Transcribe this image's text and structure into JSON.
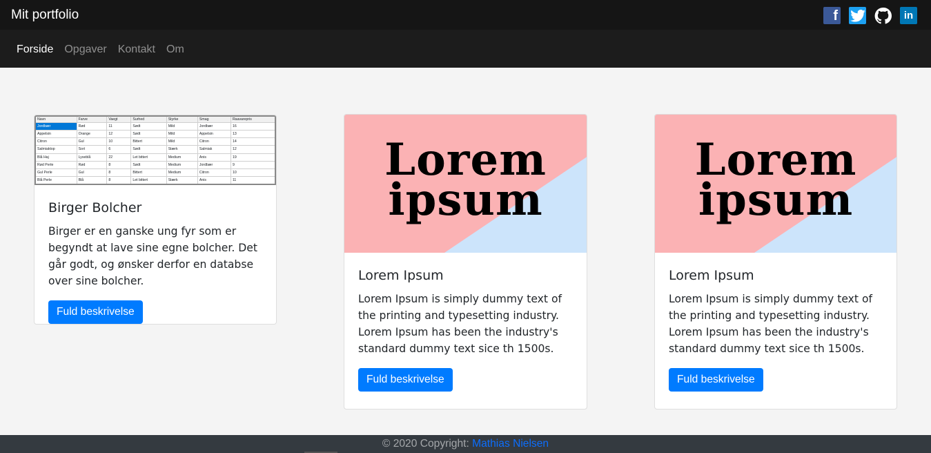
{
  "header": {
    "brand": "Mit portfolio"
  },
  "socials": [
    {
      "name": "facebook",
      "glyph": "f",
      "color": "#3b5998"
    },
    {
      "name": "twitter",
      "glyph": "t",
      "color": "#1da1f2"
    },
    {
      "name": "github",
      "glyph": "",
      "color": "#ffffff"
    },
    {
      "name": "linkedin",
      "glyph": "in",
      "color": "#0077b5"
    }
  ],
  "nav": [
    {
      "label": "Forside",
      "active": true
    },
    {
      "label": "Opgaver",
      "active": false
    },
    {
      "label": "Kontakt",
      "active": false
    },
    {
      "label": "Om",
      "active": false
    }
  ],
  "cards": [
    {
      "title": "Birger Bolcher",
      "text": "Birger er en ganske ung fyr som er begyndt at lave sine egne bolcher. Det går godt, og ønsker derfor en databse over sine bolcher.",
      "button": "Fuld beskrivelse",
      "image_table": {
        "headers": [
          "Navn",
          "Farve",
          "Vaegt",
          "Surhed",
          "Styrke",
          "Smag",
          "Raavarepris"
        ],
        "rows": [
          [
            "Jordbær",
            "Rød",
            "11",
            "Sødt",
            "Mild",
            "Jordbær",
            "16"
          ],
          [
            "Appelsin",
            "Orange",
            "12",
            "Sødt",
            "Mild",
            "Appelsin",
            "13"
          ],
          [
            "Citron",
            "Gul",
            "10",
            "Bittert",
            "Mild",
            "Citron",
            "14"
          ],
          [
            "Salmiaktop",
            "Sort",
            "6",
            "Sødt",
            "Stærk",
            "Salmiak",
            "12"
          ],
          [
            "Blå Haj",
            "Lyseblå",
            "22",
            "Let bittert",
            "Medium",
            "Anis",
            "19"
          ],
          [
            "Rød Perle",
            "Rød",
            "8",
            "Sødt",
            "Medium",
            "Jordbær",
            "9"
          ],
          [
            "Gul Perle",
            "Gul",
            "8",
            "Bittert",
            "Medium",
            "Citron",
            "10"
          ],
          [
            "Blå Perle",
            "Blå",
            "8",
            "Let bittert",
            "Stærk",
            "Anis",
            "11"
          ]
        ]
      }
    },
    {
      "title": "Lorem Ipsum",
      "text": "Lorem Ipsum is simply dummy text of the printing and typesetting industry. Lorem Ipsum has been the industry's standard dummy text sice th 1500s.",
      "button": "Fuld beskrivelse",
      "image_words": [
        "Lorem",
        "ipsum"
      ]
    },
    {
      "title": "Lorem Ipsum",
      "text": "Lorem Ipsum is simply dummy text of the printing and typesetting industry. Lorem Ipsum has been the industry's standard dummy text sice th 1500s.",
      "button": "Fuld beskrivelse",
      "image_words": [
        "Lorem",
        "ipsum"
      ]
    }
  ],
  "footer": {
    "prefix": "© 2020 Copyright: ",
    "author": "Mathias Nielsen"
  },
  "colors": {
    "primary": "#007bff",
    "pink": "#fbb2b4",
    "lightblue": "#cce4fb",
    "dark": "#151515"
  }
}
